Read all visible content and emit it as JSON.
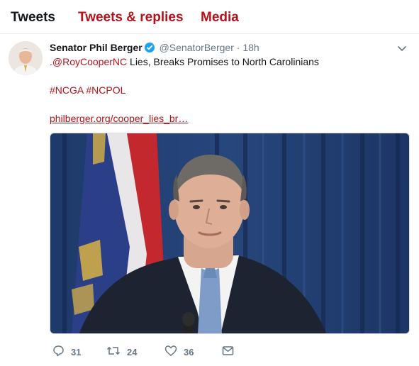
{
  "tabs": [
    {
      "label": "Tweets",
      "active": true
    },
    {
      "label": "Tweets & replies",
      "active": false
    },
    {
      "label": "Media",
      "active": false
    }
  ],
  "tweet": {
    "author_name": "Senator Phil Berger",
    "verified_icon": "verified-badge-icon",
    "handle": "@SenatorBerger",
    "separator": "·",
    "time": "18h",
    "mention": ".@RoyCooperNC",
    "headline": " Lies, Breaks Promises to North Carolinians",
    "hashtags": "#NCGA #NCPOL",
    "link": "philberger.org/cooper_lies_br…",
    "actions": {
      "reply_count": "31",
      "retweet_count": "24",
      "like_count": "36"
    }
  },
  "colors": {
    "accent": "#b5121b",
    "text": "#14171a",
    "muted": "#657786",
    "verified": "#1da1f2",
    "divider": "#e6ecf0"
  }
}
